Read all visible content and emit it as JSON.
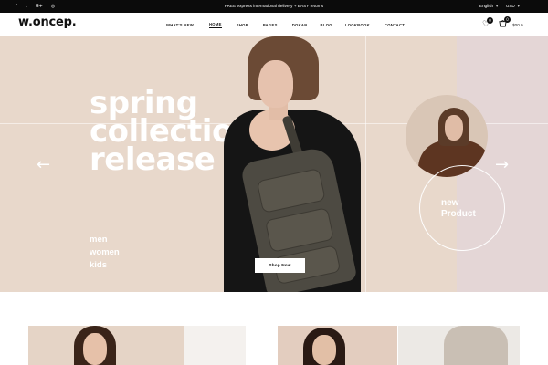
{
  "topbar": {
    "social_icons": [
      "facebook-icon",
      "twitter-icon",
      "google-plus-icon",
      "instagram-icon"
    ],
    "social_glyphs": [
      "f",
      "t",
      "G+",
      "◎"
    ],
    "promo": "FREE express international delivery + EASY returns",
    "language": "English",
    "currency": "USD"
  },
  "header": {
    "logo": "w.oncep.",
    "nav": [
      {
        "label": "WHAT'S NEW",
        "active": false
      },
      {
        "label": "HOME",
        "active": true
      },
      {
        "label": "SHOP",
        "active": false
      },
      {
        "label": "PAGES",
        "active": false
      },
      {
        "label": "DOKAN",
        "active": false
      },
      {
        "label": "BLOG",
        "active": false
      },
      {
        "label": "LOOKBOOK",
        "active": false
      },
      {
        "label": "CONTACT",
        "active": false
      }
    ],
    "wishlist_count": "0",
    "cart_count": "0",
    "cart_total": "$00.0"
  },
  "hero": {
    "title_lines": [
      "spring",
      "collection",
      "release"
    ],
    "categories": [
      "men",
      "women",
      "kids"
    ],
    "cta": "Shop Now",
    "badge_lines": [
      "new",
      "Product"
    ],
    "prev_icon": "arrow-left-icon",
    "next_icon": "arrow-right-icon"
  },
  "colors": {
    "hero_bg": "#e8d8cb",
    "hero_panel": "#e4d6d6",
    "topbar_bg": "#0b0b0b",
    "text_primary": "#111111"
  }
}
